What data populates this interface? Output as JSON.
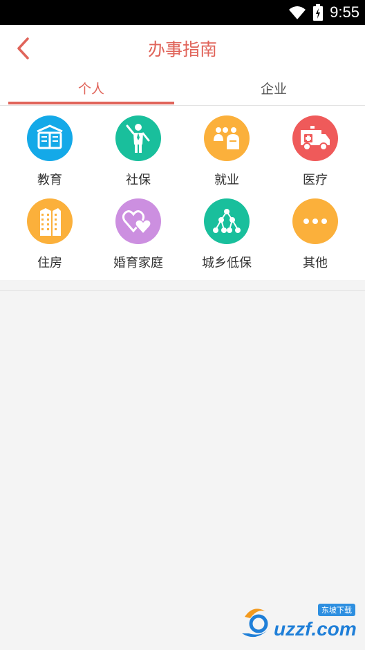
{
  "status_bar": {
    "time": "9:55"
  },
  "header": {
    "title": "办事指南",
    "back_icon": "chevron-left-icon"
  },
  "tabs": [
    {
      "label": "个人",
      "selected": true
    },
    {
      "label": "企业",
      "selected": false
    }
  ],
  "services": [
    {
      "label": "教育",
      "icon": "book-icon",
      "color": "#14a9e8"
    },
    {
      "label": "社保",
      "icon": "person-icon",
      "color": "#19bf9c"
    },
    {
      "label": "就业",
      "icon": "people-icon",
      "color": "#fbb03b"
    },
    {
      "label": "医疗",
      "icon": "ambulance-icon",
      "color": "#ef5a5a"
    },
    {
      "label": "住房",
      "icon": "building-icon",
      "color": "#fbb03b"
    },
    {
      "label": "婚育家庭",
      "icon": "hearts-icon",
      "color": "#cc8fe0"
    },
    {
      "label": "城乡低保",
      "icon": "hierarchy-icon",
      "color": "#19bf9c"
    },
    {
      "label": "其他",
      "icon": "more-icon",
      "color": "#fbb03b"
    }
  ],
  "watermark": {
    "brand": "uzzf.com",
    "badge": "东坡下载"
  },
  "colors": {
    "accent": "#e0645a",
    "status_bar": "#000000",
    "background": "#f4f4f4"
  }
}
